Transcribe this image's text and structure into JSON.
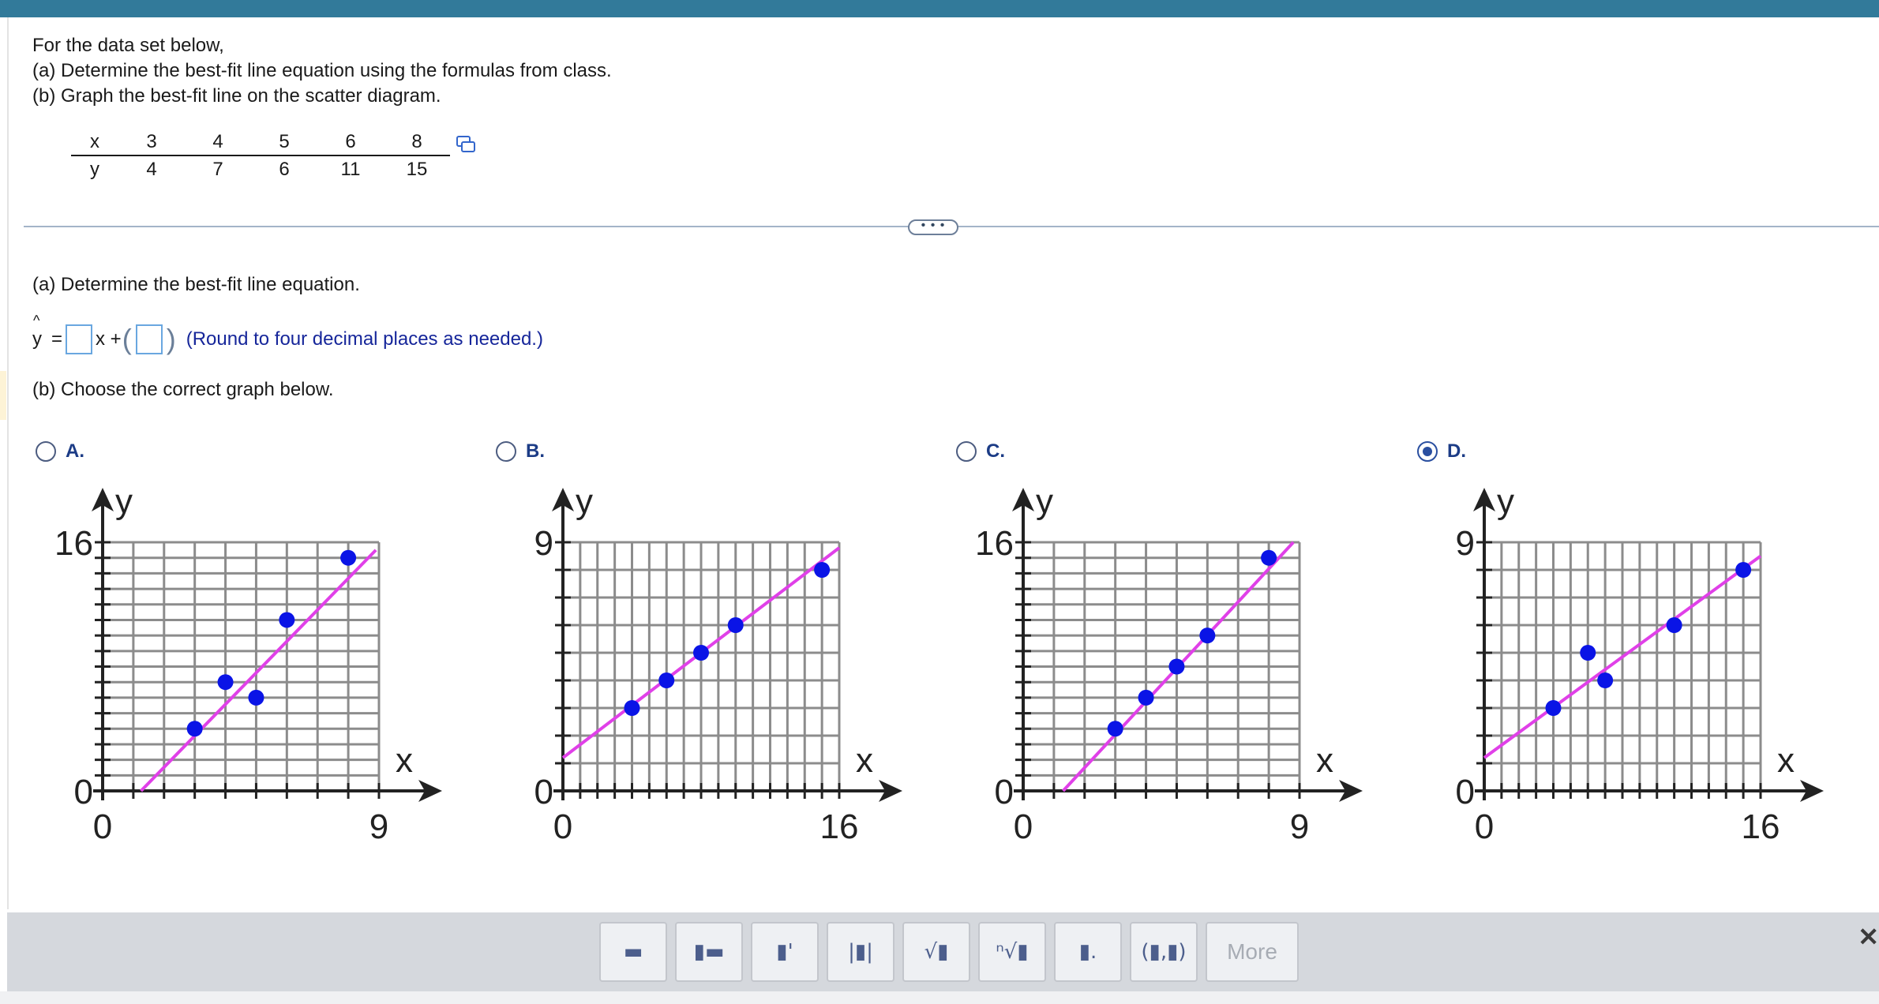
{
  "colors": {
    "topbar": "#327a9a",
    "accent": "#1c3c86",
    "line": "#e040e8",
    "point": "#0a14e6"
  },
  "question": {
    "line1": "For the data set below,",
    "line2": "(a) Determine the best-fit line equation using the formulas from class.",
    "line3": "(b) Graph the best-fit line on the scatter diagram."
  },
  "table": {
    "x_label": "x",
    "y_label": "y",
    "x": [
      "3",
      "4",
      "5",
      "6",
      "8"
    ],
    "y": [
      "4",
      "7",
      "6",
      "11",
      "15"
    ]
  },
  "divider_more": "• • •",
  "part_a": {
    "heading": "(a) Determine the best-fit line equation.",
    "yhat_symbol": "y",
    "hat": "^",
    "equals": "=",
    "x_plus": "x +",
    "paren_open": "(",
    "paren_close": ")",
    "slope_value": "",
    "intercept_value": "",
    "hint": "(Round to four decimal places as needed.)"
  },
  "part_b": {
    "heading": "(b) Choose the correct graph below."
  },
  "options": [
    {
      "label": "A.",
      "selected": false
    },
    {
      "label": "B.",
      "selected": false
    },
    {
      "label": "C.",
      "selected": false
    },
    {
      "label": "D.",
      "selected": true
    }
  ],
  "chart_data": [
    {
      "type": "scatter",
      "option": "A",
      "xlabel": "x",
      "ylabel": "y",
      "xlim": [
        0,
        9
      ],
      "ylim": [
        0,
        16
      ],
      "x_tick_labels": [
        "0",
        "9"
      ],
      "y_tick_labels": [
        "0",
        "16"
      ],
      "grid": true,
      "points": [
        [
          3,
          4
        ],
        [
          4,
          7
        ],
        [
          5,
          6
        ],
        [
          6,
          11
        ],
        [
          8,
          15
        ]
      ],
      "line": [
        [
          1.25,
          0
        ],
        [
          8.9,
          15.5
        ]
      ]
    },
    {
      "type": "scatter",
      "option": "B",
      "xlabel": "x",
      "ylabel": "y",
      "xlim": [
        0,
        16
      ],
      "ylim": [
        0,
        9
      ],
      "x_tick_labels": [
        "0",
        "16"
      ],
      "y_tick_labels": [
        "0",
        "9"
      ],
      "grid": true,
      "points": [
        [
          4,
          3
        ],
        [
          6,
          4
        ],
        [
          8,
          5
        ],
        [
          10,
          6
        ],
        [
          15,
          8
        ]
      ],
      "line": [
        [
          0,
          1.2
        ],
        [
          16,
          8.8
        ]
      ]
    },
    {
      "type": "scatter",
      "option": "C",
      "xlabel": "x",
      "ylabel": "y",
      "xlim": [
        0,
        9
      ],
      "ylim": [
        0,
        16
      ],
      "x_tick_labels": [
        "0",
        "9"
      ],
      "y_tick_labels": [
        "0",
        "16"
      ],
      "grid": true,
      "points": [
        [
          3,
          4
        ],
        [
          4,
          6
        ],
        [
          5,
          8
        ],
        [
          6,
          10
        ],
        [
          8,
          15
        ]
      ],
      "line": [
        [
          1.3,
          0
        ],
        [
          8.8,
          16
        ]
      ]
    },
    {
      "type": "scatter",
      "option": "D",
      "xlabel": "x",
      "ylabel": "y",
      "xlim": [
        0,
        16
      ],
      "ylim": [
        0,
        9
      ],
      "x_tick_labels": [
        "0",
        "16"
      ],
      "y_tick_labels": [
        "0",
        "9"
      ],
      "grid": true,
      "points": [
        [
          4,
          3
        ],
        [
          6,
          5
        ],
        [
          7,
          4
        ],
        [
          11,
          6
        ],
        [
          15,
          8
        ]
      ],
      "line": [
        [
          0,
          1.2
        ],
        [
          16,
          8.5
        ]
      ]
    }
  ],
  "toolbar": {
    "buttons": [
      {
        "name": "fraction-icon",
        "glyph": "▬"
      },
      {
        "name": "mixed-number-icon",
        "glyph": "▮▬"
      },
      {
        "name": "exponent-icon",
        "glyph": "▮'"
      },
      {
        "name": "absolute-value-icon",
        "glyph": "|▮|"
      },
      {
        "name": "square-root-icon",
        "glyph": "√▮"
      },
      {
        "name": "nth-root-icon",
        "glyph": "ⁿ√▮"
      },
      {
        "name": "subscript-icon",
        "glyph": "▮."
      },
      {
        "name": "ordered-pair-icon",
        "glyph": "(▮,▮)"
      }
    ],
    "more_label": "More",
    "close_glyph": "✕"
  }
}
